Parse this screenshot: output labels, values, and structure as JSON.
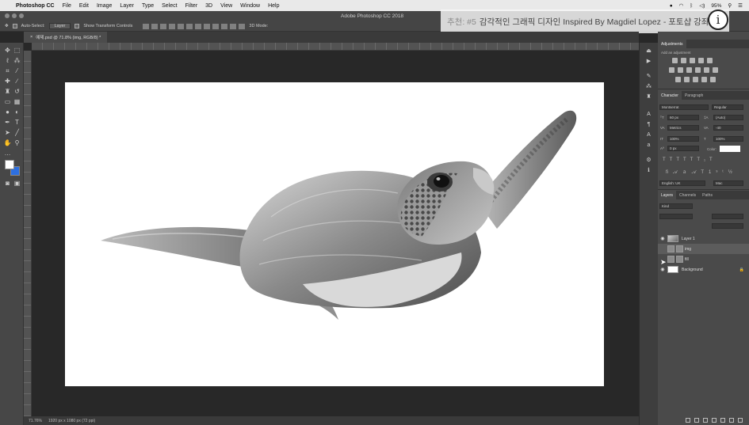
{
  "menubar": {
    "app_name": "Photoshop CC",
    "items": [
      "File",
      "Edit",
      "Image",
      "Layer",
      "Type",
      "Select",
      "Filter",
      "3D",
      "View",
      "Window",
      "Help"
    ],
    "battery": "95%",
    "status_icons": [
      "record-icon",
      "wifi-icon",
      "bluetooth-icon",
      "volume-icon",
      "search-icon",
      "menu-icon"
    ]
  },
  "window": {
    "title": "Adobe Photoshop CC 2018"
  },
  "options_bar": {
    "auto_select_label": "Auto-Select:",
    "auto_select_value": "Layer",
    "transform_label": "Show Transform Controls",
    "mode_label": "3D Mode:"
  },
  "overlay": {
    "prefix": "추천: #5",
    "title": "감각적인 그래픽 디자인 Inspired By Magdiel Lopez - 포토샵 강좌...",
    "info_label": "정보"
  },
  "document": {
    "tab_label": "예제.psd @ 71.8% (img, RGB/8) *"
  },
  "status": {
    "zoom": "71.76%",
    "doc_size": "1920 px x 1080 px (72 ppi)"
  },
  "panels": {
    "adjustments_tabs": [
      "Adjustments"
    ],
    "adjustments_hint": "Add an adjustment",
    "character_tabs": [
      "Character",
      "Paragraph"
    ],
    "font_family": "Montserrat",
    "font_style": "Regular",
    "font_size": "60 px",
    "leading": "(Auto)",
    "kerning": "Metrics",
    "tracking": "-40",
    "vertical_scale": "100%",
    "horizontal_scale": "100%",
    "baseline": "0 px",
    "color_label": "Color:",
    "language": "English: UK",
    "antialias": "Mac",
    "layers_tabs": [
      "Layers",
      "Channels",
      "Paths"
    ],
    "filter_kind": "Kind",
    "layers": [
      {
        "name": "Layer 1",
        "visible": true,
        "active": false,
        "thumb": "img"
      },
      {
        "name": "img",
        "visible": false,
        "active": true,
        "thumb": "img"
      },
      {
        "name": "fill",
        "visible": false,
        "active": false,
        "thumb": "plain"
      },
      {
        "name": "Background",
        "visible": true,
        "active": false,
        "thumb": "white",
        "locked": true
      }
    ]
  },
  "colors": {
    "foreground": "#ffffff",
    "background": "#2d6fe0"
  }
}
